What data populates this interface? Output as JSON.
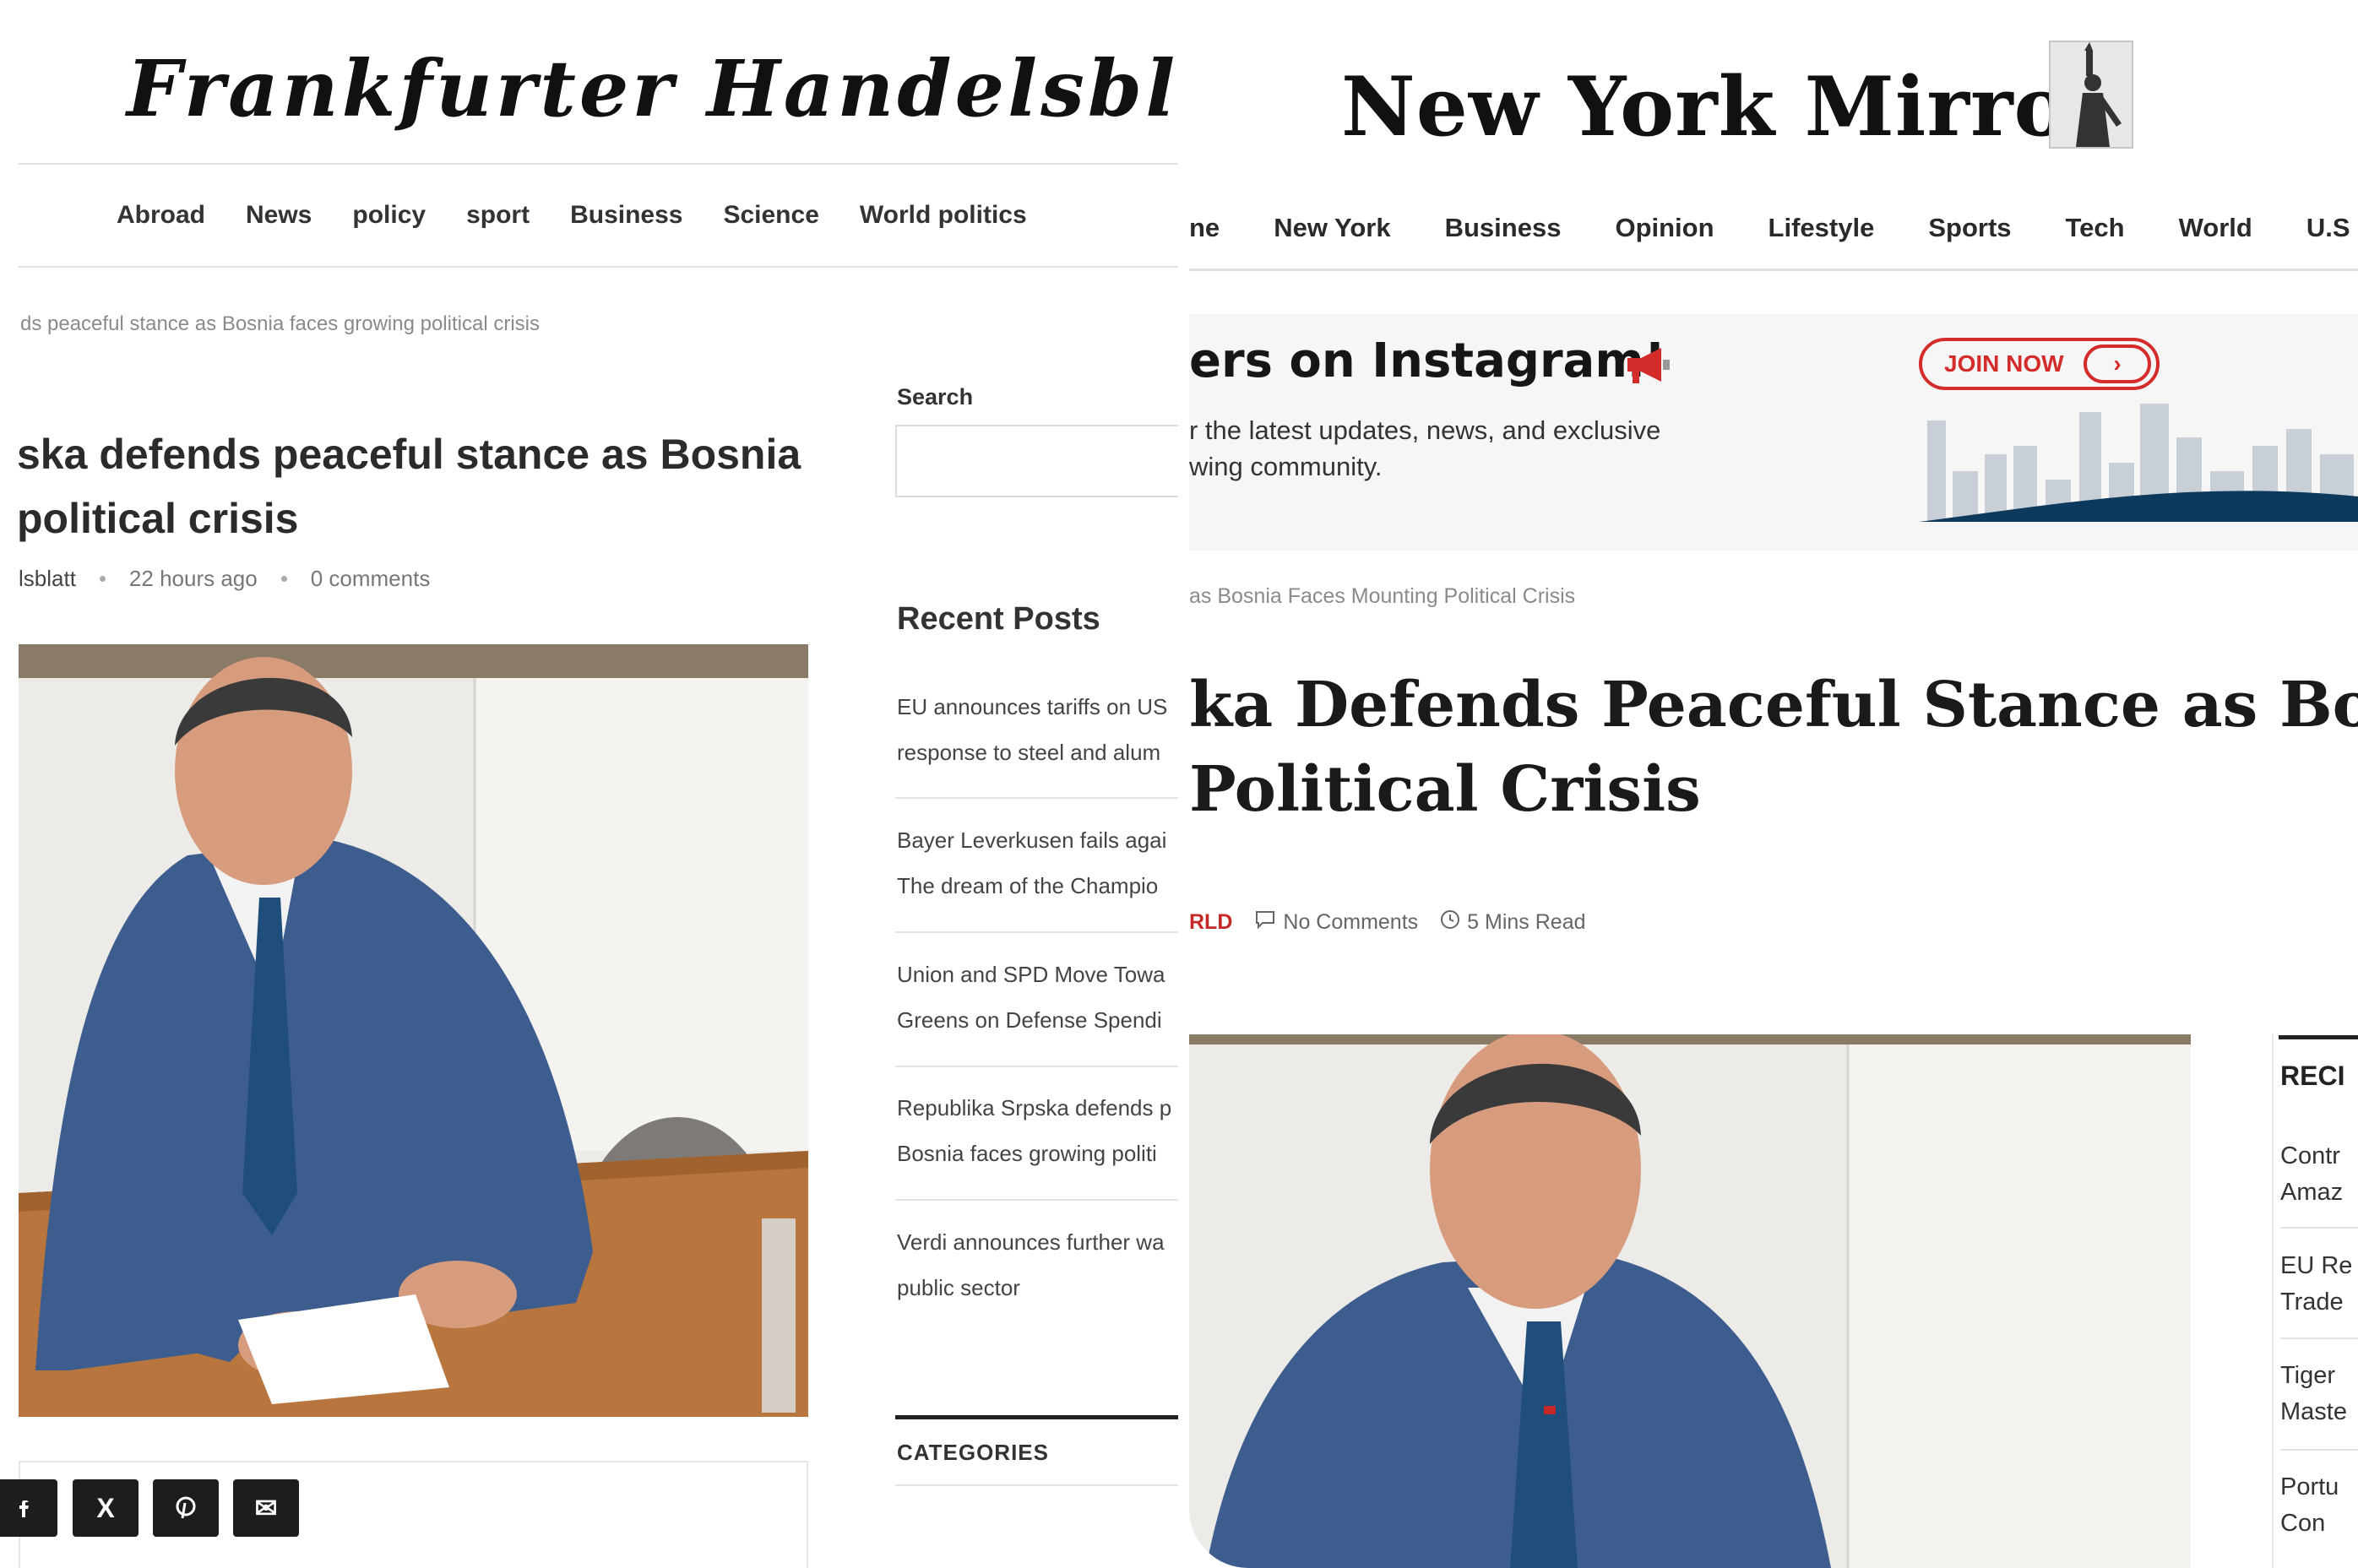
{
  "left": {
    "logo": "Frankfurter Handelsblatt",
    "nav": [
      "Abroad",
      "News",
      "policy",
      "sport",
      "Business",
      "Science",
      "World politics"
    ],
    "breadcrumb": "ds peaceful stance as Bosnia faces growing political crisis",
    "headline_line1": "ska defends peaceful stance as Bosnia",
    "headline_line2": "political crisis",
    "meta": {
      "author": "lsblatt",
      "time": "22 hours ago",
      "comments": "0 comments"
    },
    "share_icons": [
      "facebook-icon",
      "x-icon",
      "pinterest-icon",
      "email-icon"
    ],
    "share_glyphs": {
      "x": "X",
      "email": "✉"
    },
    "sidebar": {
      "search_label": "Search",
      "recent_title": "Recent Posts",
      "posts": [
        {
          "line1": "EU announces tariffs on US",
          "line2": "response to steel and alum"
        },
        {
          "line1": "Bayer Leverkusen fails agai",
          "line2": "The dream of the Champio"
        },
        {
          "line1": "Union and SPD Move Towa",
          "line2": "Greens on Defense Spendi"
        },
        {
          "line1": "Republika Srpska defends p",
          "line2": "Bosnia faces growing politi"
        },
        {
          "line1": "Verdi announces further wa",
          "line2": "public sector"
        }
      ],
      "categories_title": "CATEGORIES"
    }
  },
  "right": {
    "logo": "New York Mirror",
    "nav": [
      "ne",
      "New York",
      "Business",
      "Opinion",
      "Lifestyle",
      "Sports",
      "Tech",
      "World",
      "U.S"
    ],
    "banner": {
      "title": "ers on Instagram!",
      "line1": "r the latest updates, news, and exclusive",
      "line2": "wing community.",
      "cta": "JOIN NOW",
      "cta_arrow": "›"
    },
    "breadcrumb": "as Bosnia Faces Mounting Political Crisis",
    "headline_line1": "ka Defends Peaceful Stance as Bosnia",
    "headline_line2": " Political Crisis",
    "meta": {
      "category": "RLD",
      "comments": "No Comments",
      "read_time": "5 Mins Read"
    },
    "recent": {
      "title": "RECI",
      "items": [
        {
          "line1": "Contr",
          "line2": "Amaz"
        },
        {
          "line1": "EU Re",
          "line2": "Trade"
        },
        {
          "line1": "Tiger",
          "line2": "Maste"
        },
        {
          "line1": "Portu",
          "line2": "Con"
        }
      ]
    }
  },
  "colors": {
    "accent_red": "#c62828",
    "join_red": "#d42b2b",
    "suit_blue": "#3e5d8f",
    "tie_blue": "#1f4e7a",
    "banner_bg": "#f6f6f6",
    "skyline": "#c9cfd6",
    "wave": "#0d3a5c"
  }
}
